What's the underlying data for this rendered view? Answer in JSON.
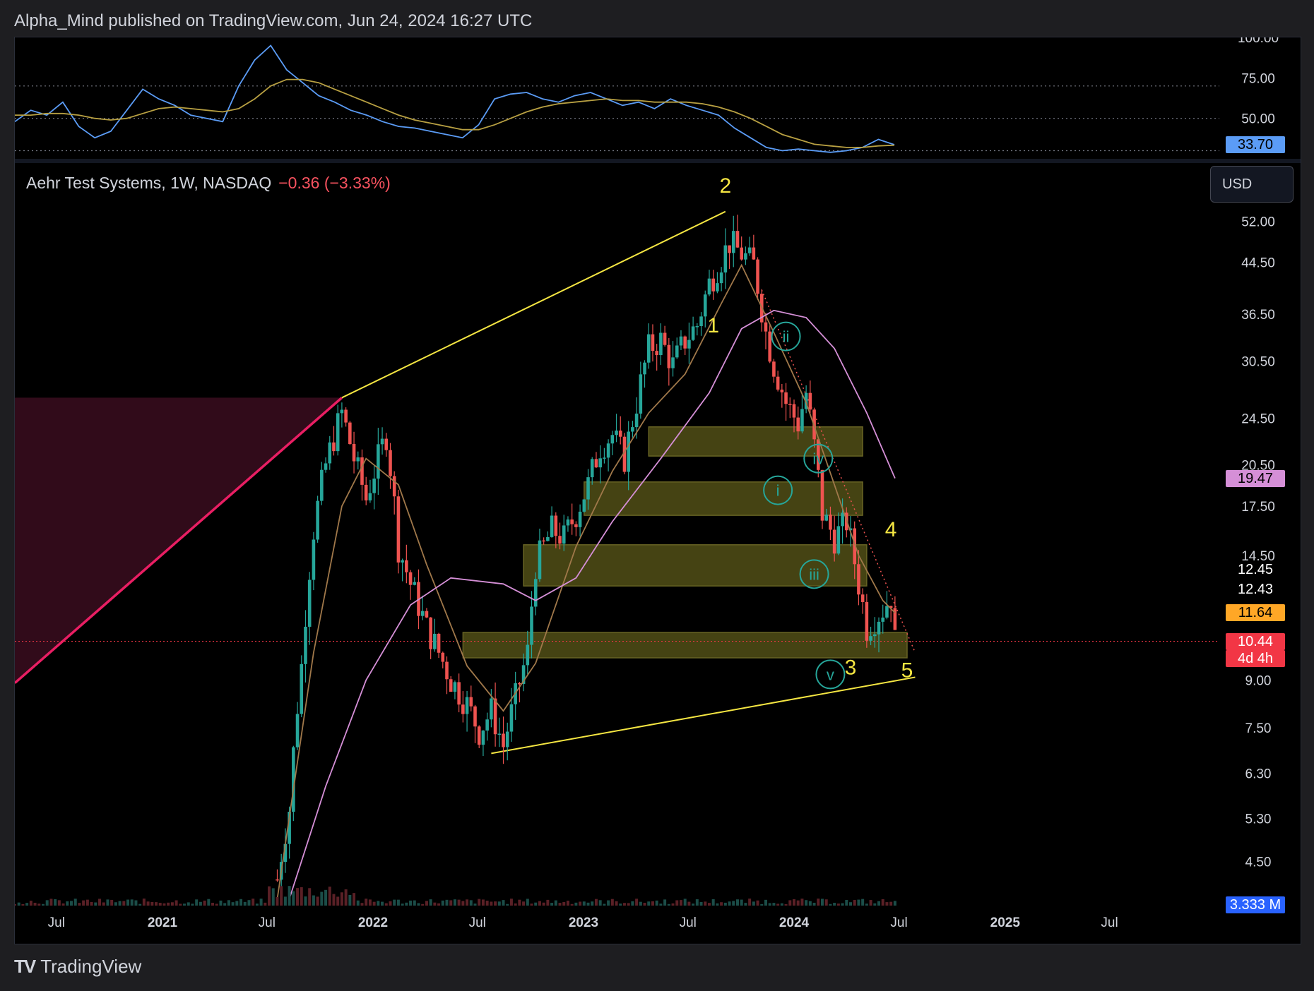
{
  "header": {
    "published": "Alpha_Mind published on TradingView.com, Jun 24, 2024 16:27 UTC"
  },
  "legend": {
    "symbol": "Aehr Test Systems, 1W, NASDAQ",
    "change": "−0.36 (−3.33%)"
  },
  "currency_button": "USD",
  "footer": {
    "brand": "TradingView",
    "logo": "TV"
  },
  "colors": {
    "background": "#000000",
    "up_candle": "#26a69a",
    "down_candle": "#ef5350",
    "rsi_line": "#5b9cf6",
    "rsi_ma": "#b8a042",
    "ma_fast": "#a0784a",
    "ma_slow": "#d58fd7",
    "annotation_yellow": "#f5e642",
    "zone_fill": "#5c5a1a",
    "circle_teal": "#26a69a",
    "pink_line": "#e91e63"
  },
  "price_labels": [
    {
      "id": "rsi-value",
      "text": "33.70",
      "bg": "#5b9cf6",
      "fg": "#000000"
    },
    {
      "id": "ma-slow-value",
      "text": "19.47",
      "bg": "#d58fd7",
      "fg": "#000000"
    },
    {
      "id": "ma-fast-value",
      "text": "11.64",
      "bg": "#ffa726",
      "fg": "#000000"
    },
    {
      "id": "last-price",
      "text": "10.44",
      "bg": "#f23645",
      "fg": "#ffffff"
    },
    {
      "id": "countdown",
      "text": "4d 4h",
      "bg": "#f23645",
      "fg": "#ffffff"
    },
    {
      "id": "volume-value",
      "text": "3.333 M",
      "bg": "#2962ff",
      "fg": "#ffffff"
    },
    {
      "id": "high-label",
      "text": "12.45",
      "bg": "",
      "fg": "#ffffff"
    },
    {
      "id": "low-label",
      "text": "12.43",
      "bg": "",
      "fg": "#ffffff"
    }
  ],
  "chart_data": [
    {
      "type": "line",
      "name": "RSI pane",
      "y_ticks": [
        "100.00",
        "75.00",
        "50.00"
      ],
      "ylim": [
        25,
        100
      ],
      "dotted_levels": [
        70,
        50,
        30
      ],
      "series": [
        {
          "key": "rsi",
          "values": [
            48,
            55,
            52,
            60,
            45,
            38,
            42,
            55,
            68,
            62,
            58,
            52,
            50,
            48,
            70,
            86,
            95,
            80,
            72,
            64,
            60,
            55,
            52,
            48,
            45,
            44,
            42,
            40,
            38,
            46,
            62,
            65,
            66,
            62,
            60,
            64,
            66,
            62,
            58,
            60,
            56,
            62,
            58,
            55,
            52,
            44,
            38,
            32,
            30,
            31,
            30,
            29,
            30,
            32,
            37,
            33.7
          ]
        },
        {
          "key": "rsi_ma",
          "values": [
            52,
            52,
            53,
            53,
            52,
            50,
            49,
            50,
            53,
            56,
            57,
            56,
            55,
            54,
            56,
            62,
            70,
            74,
            74,
            72,
            68,
            64,
            60,
            56,
            52,
            49,
            47,
            45,
            43,
            43,
            46,
            50,
            54,
            57,
            59,
            60,
            61,
            62,
            61,
            61,
            60,
            60,
            60,
            59,
            57,
            54,
            50,
            45,
            40,
            37,
            34,
            33,
            32,
            32,
            33,
            33.4
          ]
        }
      ]
    },
    {
      "type": "candlestick",
      "name": "Aehr Test Systems, 1W, NASDAQ",
      "scale": "log",
      "y_ticks": [
        "52.00",
        "44.50",
        "36.50",
        "30.50",
        "24.50",
        "20.50",
        "17.50",
        "14.50",
        "9.00",
        "7.50",
        "6.30",
        "5.30",
        "4.50"
      ],
      "ylim": [
        3.8,
        65
      ],
      "x_ticks": [
        "Jul",
        "2021",
        "Jul",
        "2022",
        "Jul",
        "2023",
        "Jul",
        "2024",
        "Jul",
        "2025",
        "Jul"
      ],
      "x_tick_dates": [
        "2020-07-01",
        "2021-01-01",
        "2021-07-01",
        "2022-01-01",
        "2022-07-01",
        "2023-01-01",
        "2023-07-01",
        "2024-01-01",
        "2024-07-01",
        "2025-01-01",
        "2025-07-01"
      ],
      "xlim": [
        "2020-04-20",
        "2025-12-20"
      ],
      "price_path": [
        [
          "2021-07-19",
          4.2
        ],
        [
          "2021-08-09",
          5.5
        ],
        [
          "2021-08-30",
          9.5
        ],
        [
          "2021-09-20",
          16
        ],
        [
          "2021-10-11",
          20.5
        ],
        [
          "2021-11-08",
          25
        ],
        [
          "2021-11-29",
          21
        ],
        [
          "2021-12-20",
          18
        ],
        [
          "2022-01-10",
          21
        ],
        [
          "2022-01-24",
          23
        ],
        [
          "2022-02-14",
          15
        ],
        [
          "2022-03-07",
          13
        ],
        [
          "2022-04-04",
          11
        ],
        [
          "2022-04-25",
          10
        ],
        [
          "2022-05-16",
          9
        ],
        [
          "2022-06-13",
          8.2
        ],
        [
          "2022-07-04",
          7.4
        ],
        [
          "2022-07-25",
          8
        ],
        [
          "2022-08-15",
          7
        ],
        [
          "2022-09-05",
          8.4
        ],
        [
          "2022-09-26",
          10
        ],
        [
          "2022-10-10",
          14
        ],
        [
          "2022-11-07",
          16
        ],
        [
          "2022-11-28",
          15.5
        ],
        [
          "2022-12-19",
          17
        ],
        [
          "2023-01-09",
          19
        ],
        [
          "2023-01-30",
          22
        ],
        [
          "2023-02-20",
          23
        ],
        [
          "2023-03-13",
          21
        ],
        [
          "2023-04-03",
          26
        ],
        [
          "2023-04-24",
          32
        ],
        [
          "2023-05-15",
          33
        ],
        [
          "2023-06-05",
          30
        ],
        [
          "2023-06-26",
          33
        ],
        [
          "2023-07-17",
          35
        ],
        [
          "2023-08-07",
          41
        ],
        [
          "2023-08-28",
          45
        ],
        [
          "2023-09-11",
          48
        ],
        [
          "2023-10-02",
          46
        ],
        [
          "2023-10-23",
          44
        ],
        [
          "2023-11-13",
          34
        ],
        [
          "2023-11-27",
          30
        ],
        [
          "2023-12-18",
          26
        ],
        [
          "2024-01-08",
          24
        ],
        [
          "2024-01-22",
          27
        ],
        [
          "2024-02-05",
          22
        ],
        [
          "2024-02-19",
          17
        ],
        [
          "2024-03-11",
          15.5
        ],
        [
          "2024-04-01",
          16.5
        ],
        [
          "2024-04-22",
          13
        ],
        [
          "2024-05-06",
          11
        ],
        [
          "2024-05-20",
          11.4
        ],
        [
          "2024-06-03",
          11.8
        ],
        [
          "2024-06-17",
          12.4
        ],
        [
          "2024-06-24",
          10.44
        ]
      ],
      "ma_fast": [
        [
          "2021-07-19",
          3.9
        ],
        [
          "2021-09-20",
          10
        ],
        [
          "2021-11-08",
          17.5
        ],
        [
          "2021-12-20",
          21
        ],
        [
          "2022-02-14",
          19
        ],
        [
          "2022-04-04",
          14
        ],
        [
          "2022-06-13",
          9.5
        ],
        [
          "2022-08-15",
          8
        ],
        [
          "2022-10-10",
          9.6
        ],
        [
          "2022-12-19",
          15
        ],
        [
          "2023-02-20",
          20
        ],
        [
          "2023-04-24",
          25
        ],
        [
          "2023-06-26",
          29
        ],
        [
          "2023-08-28",
          38
        ],
        [
          "2023-10-02",
          44
        ],
        [
          "2023-11-27",
          34
        ],
        [
          "2024-01-22",
          26
        ],
        [
          "2024-03-11",
          19
        ],
        [
          "2024-04-22",
          14.5
        ],
        [
          "2024-06-03",
          12.2
        ],
        [
          "2024-06-24",
          11.64
        ]
      ],
      "ma_slow": [
        [
          "2021-08-09",
          3.9
        ],
        [
          "2021-10-11",
          6
        ],
        [
          "2021-12-20",
          9
        ],
        [
          "2022-03-07",
          12
        ],
        [
          "2022-05-16",
          13.3
        ],
        [
          "2022-08-15",
          13
        ],
        [
          "2022-10-10",
          12.2
        ],
        [
          "2022-12-19",
          13.3
        ],
        [
          "2023-02-20",
          16.5
        ],
        [
          "2023-05-15",
          21
        ],
        [
          "2023-08-07",
          27
        ],
        [
          "2023-10-02",
          34.5
        ],
        [
          "2023-11-27",
          37
        ],
        [
          "2024-01-22",
          36
        ],
        [
          "2024-03-11",
          32
        ],
        [
          "2024-05-06",
          25
        ],
        [
          "2024-06-24",
          19.47
        ]
      ],
      "volume_label": "3.333 M",
      "last_price": 10.44,
      "annotations": {
        "wave_numbers": [
          {
            "label": "1",
            "date": "2023-08-14",
            "price": 34
          },
          {
            "label": "2",
            "date": "2023-09-04",
            "price": 58
          },
          {
            "label": "3",
            "date": "2024-04-08",
            "price": 9.2
          },
          {
            "label": "4",
            "date": "2024-06-17",
            "price": 15.6
          },
          {
            "label": "5",
            "date": "2024-07-15",
            "price": 9.1
          }
        ],
        "subwaves": [
          {
            "label": "i",
            "date": "2023-12-04",
            "price": 18.6
          },
          {
            "label": "ii",
            "date": "2023-12-18",
            "price": 33.5
          },
          {
            "label": "iii",
            "date": "2024-02-05",
            "price": 13.5
          },
          {
            "label": "iv",
            "date": "2024-02-12",
            "price": 21
          },
          {
            "label": "v",
            "date": "2024-03-04",
            "price": 9.2
          }
        ],
        "zones": [
          {
            "from": "2023-04-24",
            "to": "2024-04-29",
            "low": 21.2,
            "high": 23.7
          },
          {
            "from": "2023-01-02",
            "to": "2024-04-29",
            "low": 16.9,
            "high": 19.2
          },
          {
            "from": "2022-09-19",
            "to": "2024-05-06",
            "low": 12.9,
            "high": 15.1
          },
          {
            "from": "2022-06-06",
            "to": "2024-07-15",
            "low": 9.8,
            "high": 10.8
          }
        ],
        "upper_trendline": [
          [
            "2021-11-08",
            26.5
          ],
          [
            "2023-09-04",
            54
          ]
        ],
        "lower_trendline": [
          [
            "2022-07-25",
            6.8
          ],
          [
            "2024-07-29",
            9.1
          ]
        ]
      }
    }
  ]
}
